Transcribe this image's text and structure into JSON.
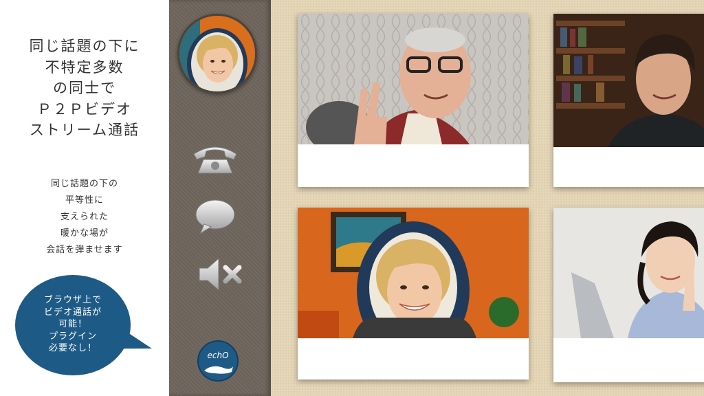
{
  "promo": {
    "headline": "同じ話題の下に\n不特定多数\nの同士で\nＰ２Ｐビデオ\nストリーム通話",
    "subline": "同じ話題の下の\n平等性に\n支えられた\n暖かな場が\n会話を弾ませます",
    "bubble": "ブラウザ上で\nビデオ通話が\n可能！\nプラグイン\n必要なし！"
  },
  "controls": {
    "icons": [
      "phone-icon",
      "chat-bubble-icon",
      "mute-speaker-icon"
    ],
    "logo_text": "echO"
  },
  "videos": {
    "participants": [
      {
        "name": "",
        "caption": ""
      },
      {
        "name": "",
        "caption": ""
      },
      {
        "name": "",
        "caption": ""
      },
      {
        "name": "",
        "caption": ""
      }
    ]
  },
  "colors": {
    "accent": "#1e5a86",
    "control_bg": "#6e655c",
    "video_bg": "#e5d6b7"
  }
}
